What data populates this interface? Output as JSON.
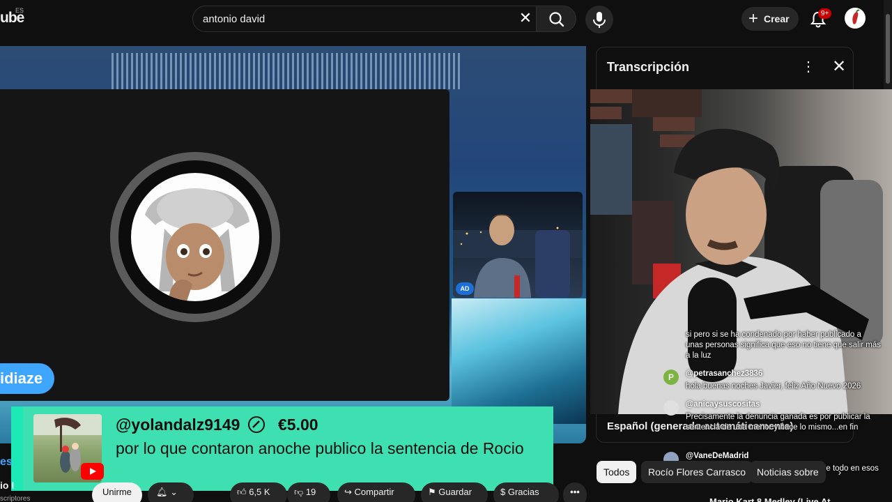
{
  "header": {
    "logo_text": "ube",
    "region": "ES",
    "search_value": "antonio david",
    "create_label": "Crear",
    "notifications_badge": "9+"
  },
  "player": {
    "name_pill": "idiaze",
    "ad_badge": "AD"
  },
  "superchat": {
    "username": "@yolandalz9149",
    "amount": "€5.00",
    "message": "por lo que contaron anoche publico la sentencia de Rocio"
  },
  "below_player": {
    "channel_fragment": "es",
    "channel_name_fragment": "io I",
    "subscribers_fragment": "scriptores",
    "subscribe_label": "Unirme",
    "likes": "6,5 K",
    "dislikes": "19",
    "share_label": "Compartir",
    "save_label": "Guardar",
    "thanks_label": "Gracias"
  },
  "transcript": {
    "title": "Transcripción",
    "language": "Español (generado automáticamente)"
  },
  "chat": [
    {
      "author": "",
      "message": "si pero si se ha condenado por haber publicado a unas personas significa que eso no tiene que salir más a la luz"
    },
    {
      "author": "@petrasanchez3836",
      "message": "hola buenas noches Javier, feliz Año Nuevo 2026",
      "avatar_letter": "P",
      "avatar_color": "#7cb342"
    },
    {
      "author": "@anicaysuscositas",
      "message": "Precisamente la denuncia ganada es por publicar la sentencia de una menor y hace lo mismo...en fin"
    },
    {
      "author": "@VaneDeMadrid",
      "message": "no solo la sentencia si no que la puso de todo en esos tweets"
    }
  ],
  "chips": [
    "Todos",
    "Rocío Flores Carrasco",
    "Noticias sobre"
  ],
  "next_video_title": "Mario Kart 8 Medley (Live At",
  "colors": {
    "accent_blue": "#3ea6ff",
    "superchat_green": "#3ee0b2",
    "notification_red": "#cc0000"
  }
}
